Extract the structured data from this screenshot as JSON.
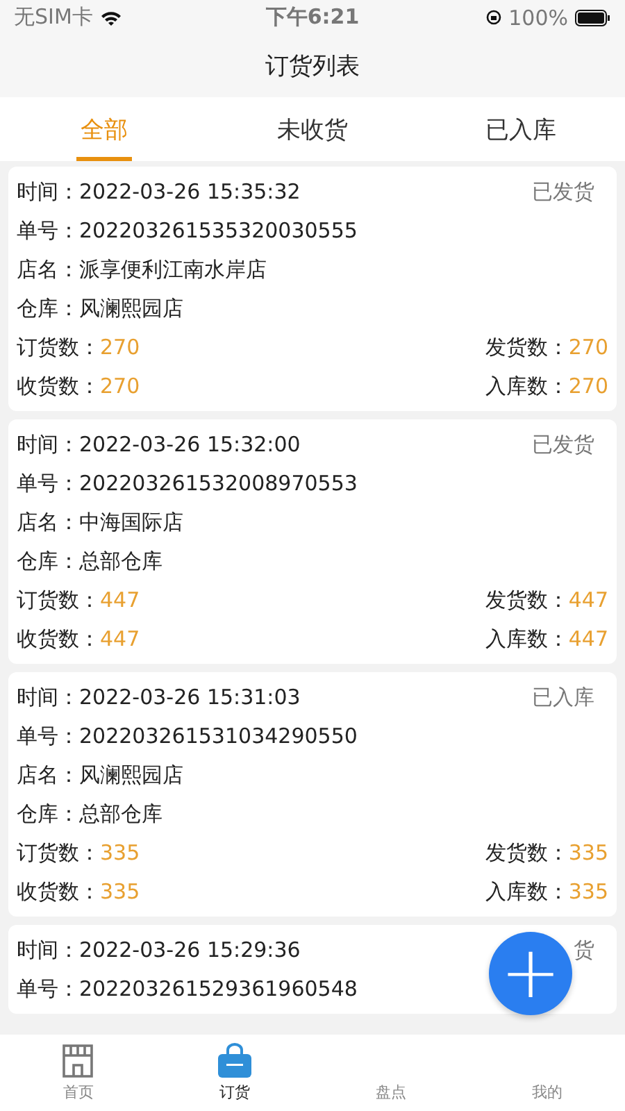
{
  "status_bar": {
    "carrier": "无SIM卡",
    "time": "下午6:21",
    "battery": "100%"
  },
  "title": "订货列表",
  "tabs": [
    {
      "label": "全部",
      "selected": true
    },
    {
      "label": "未收货",
      "selected": false
    },
    {
      "label": "已入库",
      "selected": false
    }
  ],
  "orders": [
    {
      "time_label": "时间：",
      "time": "2022-03-26 15:35:32",
      "status": "已发货",
      "no_label": "单号：",
      "no": "202203261535320030555",
      "store_label": "店名：",
      "store": "派享便利江南水岸店",
      "warehouse_label": "仓库：",
      "warehouse": "风澜熙园店",
      "counts": [
        {
          "label": "订货数：",
          "value": "270"
        },
        {
          "label": "发货数：",
          "value": "270"
        },
        {
          "label": "收货数：",
          "value": "270"
        },
        {
          "label": "入库数：",
          "value": "270"
        }
      ]
    },
    {
      "time_label": "时间：",
      "time": "2022-03-26 15:32:00",
      "status": "已发货",
      "no_label": "单号：",
      "no": "202203261532008970553",
      "store_label": "店名：",
      "store": "中海国际店",
      "warehouse_label": "仓库：",
      "warehouse": "总部仓库",
      "counts": [
        {
          "label": "订货数：",
          "value": "447"
        },
        {
          "label": "发货数：",
          "value": "447"
        },
        {
          "label": "收货数：",
          "value": "447"
        },
        {
          "label": "入库数：",
          "value": "447"
        }
      ]
    },
    {
      "time_label": "时间：",
      "time": "2022-03-26 15:31:03",
      "status": "已入库",
      "no_label": "单号：",
      "no": "202203261531034290550",
      "store_label": "店名：",
      "store": "风澜熙园店",
      "warehouse_label": "仓库：",
      "warehouse": "总部仓库",
      "counts": [
        {
          "label": "订货数：",
          "value": "335"
        },
        {
          "label": "发货数：",
          "value": "335"
        },
        {
          "label": "收货数：",
          "value": "335"
        },
        {
          "label": "入库数：",
          "value": "335"
        }
      ]
    },
    {
      "time_label": "时间：",
      "time": "2022-03-26 15:29:36",
      "status": "货",
      "no_label": "单号：",
      "no": "202203261529361960548"
    }
  ],
  "fab": {
    "icon": "+"
  },
  "nav": [
    {
      "label": "首页",
      "selected": false,
      "kind": "shop"
    },
    {
      "label": "订货",
      "selected": true,
      "kind": "bag"
    },
    {
      "label": "盘点",
      "selected": false,
      "kind": "none"
    },
    {
      "label": "我的",
      "selected": false,
      "kind": "none"
    }
  ]
}
